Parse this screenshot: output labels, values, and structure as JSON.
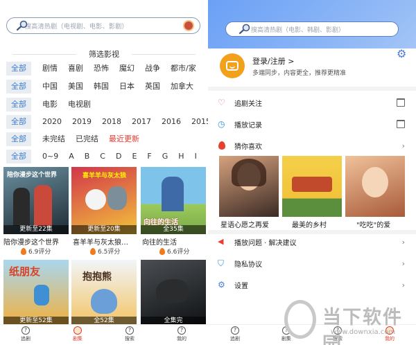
{
  "left": {
    "search_placeholder": "搜高清热剧（电视剧、电影、影剧）",
    "section_title": "筛选影视",
    "filters": [
      {
        "all": "全部",
        "options": [
          "剧情",
          "喜剧",
          "恐怖",
          "魔幻",
          "战争",
          "都市/家"
        ]
      },
      {
        "all": "全部",
        "options": [
          "中国",
          "美国",
          "韩国",
          "日本",
          "英国",
          "加拿大"
        ]
      },
      {
        "all": "全部",
        "options": [
          "电影",
          "电视剧"
        ]
      },
      {
        "all": "全部",
        "options": [
          "2020",
          "2019",
          "2018",
          "2017",
          "2016",
          "2015"
        ]
      },
      {
        "all": "全部",
        "options": [
          "未完结",
          "已完结"
        ],
        "highlight": "最近更新"
      },
      {
        "all": "全部",
        "options": [
          "0~9",
          "A",
          "B",
          "C",
          "D",
          "E",
          "F",
          "G",
          "H",
          "I"
        ]
      }
    ],
    "posters": [
      {
        "caption": "更新至22集",
        "title": "陪你漫步这个世界",
        "score": "6.9评分",
        "colors": [
          "#5a7d8c",
          "#1f2b33"
        ]
      },
      {
        "caption": "更新至20集",
        "title": "喜羊羊与灰太狼…",
        "score": "6.5评分",
        "colors": [
          "#d2364a",
          "#f3c43c"
        ]
      },
      {
        "caption": "全35集",
        "title": "向往的生活",
        "score": "6.6评分",
        "colors": [
          "#6cb8e0",
          "#9ccb5c"
        ]
      },
      {
        "caption": "更新至52集",
        "title": "",
        "score": "",
        "colors": [
          "#9cd0ee",
          "#f2b03c"
        ]
      },
      {
        "caption": "全52集",
        "title": "",
        "score": "",
        "colors": [
          "#e9f1f8",
          "#f4c463"
        ]
      },
      {
        "caption": "全集完",
        "title": "",
        "score": "",
        "colors": [
          "#3a3e42",
          "#101214"
        ]
      }
    ],
    "poster_titles": {
      "p1": "陪你漫步这个世界",
      "p2": "喜羊羊与灰太狼",
      "p3": "向往的生活",
      "p4": "纸朋友",
      "p5": "抱抱熊"
    },
    "tabs": [
      {
        "label": "追剧"
      },
      {
        "label": "剧集"
      },
      {
        "label": "搜索"
      },
      {
        "label": "我的"
      }
    ]
  },
  "right": {
    "search_placeholder": "搜高清热剧（电影、韩剧、影剧）",
    "login_title": "登录/注册 >",
    "login_subtitle": "多端同步，内容更全，推荐更精准",
    "menu": {
      "follow": "追剧关注",
      "history": "播放记录",
      "guess": "猜你喜欢",
      "feedback": "播放问题 · 解决建议",
      "privacy": "隐私协议",
      "settings": "设置"
    },
    "guess_items": [
      {
        "title": "星语心愿之再爱",
        "colors": [
          "#c89070",
          "#3b2a24"
        ]
      },
      {
        "title": "最美的乡村",
        "colors": [
          "#f1c33a",
          "#5b8f3d"
        ]
      },
      {
        "title": "\"吃吃\"的爱",
        "colors": [
          "#e7b38a",
          "#a85a3a"
        ]
      }
    ],
    "tabs": [
      {
        "label": "追剧"
      },
      {
        "label": "剧集"
      },
      {
        "label": "搜索"
      },
      {
        "label": "我的"
      }
    ]
  },
  "watermark": {
    "text": "当下软件园",
    "url": "www.downxia.com"
  },
  "colors": {
    "accent_blue": "#3a7bd5",
    "accent_red": "#e23b2e",
    "header_blue": "#6aa0f5"
  }
}
